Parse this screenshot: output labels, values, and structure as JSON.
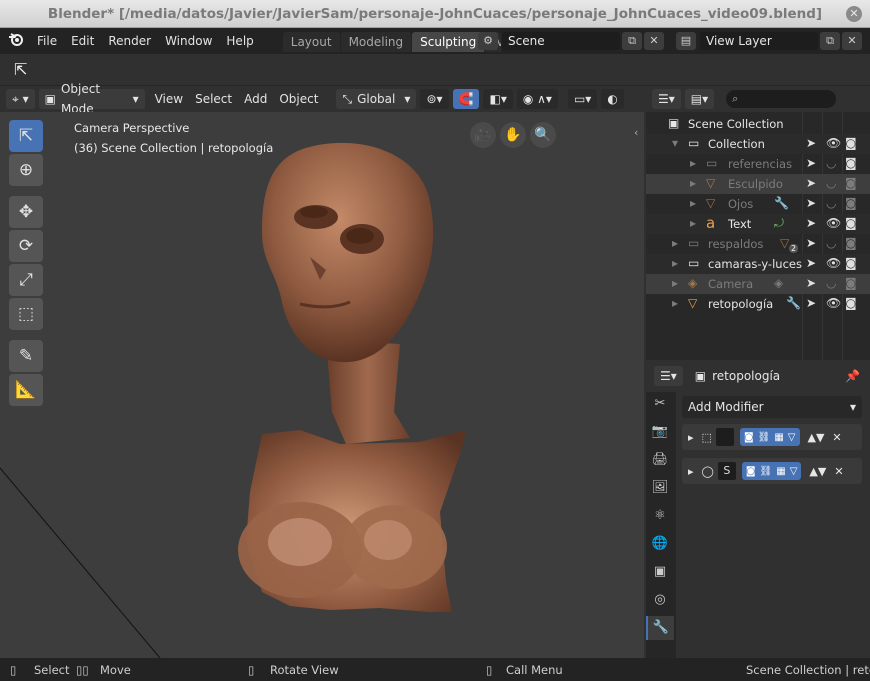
{
  "window": {
    "title": "Blender* [/media/datos/Javier/JavierSam/personaje-JohnCuaces/personaje_JohnCuaces_video09.blend]",
    "close_glyph": "✕"
  },
  "menubar": {
    "logo": "blender-logo",
    "items": [
      "File",
      "Edit",
      "Render",
      "Window",
      "Help"
    ],
    "workspace_tabs": [
      "Layout",
      "Modeling",
      "Sculpting",
      "UV"
    ],
    "active_tab": "Sculpting",
    "scene_label": "Scene",
    "view_layer_label": "View Layer"
  },
  "viewport_header": {
    "mode": "Object Mode",
    "menus": [
      "View",
      "Select",
      "Add",
      "Object"
    ],
    "transform_orientation": "Global"
  },
  "viewport": {
    "perspective": "Camera Perspective",
    "collection_info": "(36) Scene Collection | retopología",
    "background_color": "#3d3d3d"
  },
  "outliner": {
    "rows": [
      {
        "label": "Scene Collection",
        "icon": "scene-collection-icon",
        "state": "normal"
      },
      {
        "label": "Collection",
        "icon": "collection-icon",
        "state": "normal"
      },
      {
        "label": "referencias",
        "icon": "collection-icon",
        "state": "dim"
      },
      {
        "label": "Esculpido",
        "icon": "mesh-icon",
        "state": "dim"
      },
      {
        "label": "Ojos",
        "icon": "mesh-icon",
        "state": "dim"
      },
      {
        "label": "Text",
        "icon": "text-icon",
        "state": "normal"
      },
      {
        "label": "respaldos",
        "icon": "collection-icon",
        "state": "dim"
      },
      {
        "label": "camaras-y-luces",
        "icon": "collection-icon",
        "state": "normal"
      },
      {
        "label": "Camera",
        "icon": "camera-icon",
        "state": "dim"
      },
      {
        "label": "retopología",
        "icon": "mesh-icon",
        "state": "normal"
      }
    ],
    "badge_count": "2"
  },
  "properties": {
    "object_name": "retopología",
    "add_modifier_label": "Add Modifier",
    "modifier_1_name": "",
    "modifier_2_name": "S"
  },
  "statusbar": {
    "select": "Select",
    "move": "Move",
    "rotate": "Rotate View",
    "call_menu": "Call Menu",
    "scene_info": "Scene Collection | retopo"
  },
  "colors": {
    "accent": "#4772b3",
    "skin_highlight": "#c48a68",
    "skin_shadow": "#5a3322"
  }
}
